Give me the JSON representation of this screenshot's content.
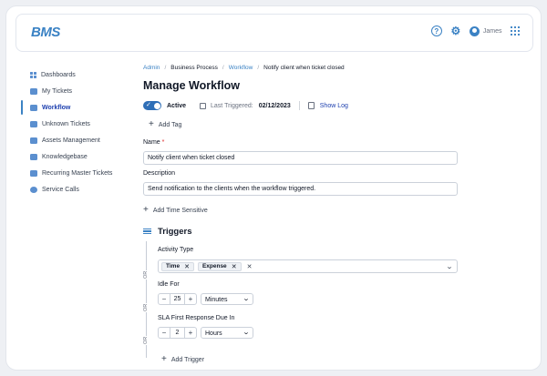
{
  "app": {
    "logo": "BMS"
  },
  "header": {
    "user_name": "James",
    "help_icon": "?"
  },
  "sidebar": {
    "items": [
      {
        "label": "Dashboards",
        "icon": "dashboard-icon",
        "active": false
      },
      {
        "label": "My Tickets",
        "icon": "ticket-icon",
        "active": false
      },
      {
        "label": "Workflow",
        "icon": "workflow-icon",
        "active": true
      },
      {
        "label": "Unknown Tickets",
        "icon": "unknown-ticket-icon",
        "active": false
      },
      {
        "label": "Assets Management",
        "icon": "assets-icon",
        "active": false
      },
      {
        "label": "Knowledgebase",
        "icon": "book-icon",
        "active": false
      },
      {
        "label": "Recurring Master Tickets",
        "icon": "recurring-icon",
        "active": false
      },
      {
        "label": "Service Calls",
        "icon": "service-call-icon",
        "active": false
      }
    ]
  },
  "breadcrumb": {
    "items": [
      "Admin",
      "Business Process",
      "Workflow",
      "Notify client when ticket closed"
    ],
    "separator": "/"
  },
  "page": {
    "title": "Manage Workflow"
  },
  "status": {
    "active_label": "Active",
    "active_checkmark": "✓",
    "last_triggered_label": "Last Triggered:",
    "last_triggered_value": "02/12/2023",
    "show_log_label": "Show Log"
  },
  "add_tag_label": "Add Tag",
  "form": {
    "name_label": "Name",
    "name_required_mark": "*",
    "name_value": "Notify client when ticket closed",
    "description_label": "Description",
    "description_value": "Send notification to the clients when the workflow triggered."
  },
  "add_time_sensitive_label": "Add Time Sensitive",
  "triggers": {
    "title": "Triggers",
    "or_label": "OR",
    "activity_type": {
      "label": "Activity Type",
      "chips": [
        "Time",
        "Expense"
      ],
      "chip_remove": "✕",
      "clear": "✕",
      "chevron": "⌄"
    },
    "idle_for": {
      "label": "Idle For",
      "value": "25",
      "unit": "Minutes",
      "minus": "−",
      "plus": "+"
    },
    "sla_first_response": {
      "label": "SLA First Response Due In",
      "value": "2",
      "unit": "Hours",
      "minus": "−",
      "plus": "+"
    },
    "add_trigger_label": "Add Trigger"
  },
  "plus_glyph": "+",
  "colors": {
    "accent": "#3b82c4",
    "toggle_on": "#2f6fb7",
    "required": "#dc2626"
  }
}
